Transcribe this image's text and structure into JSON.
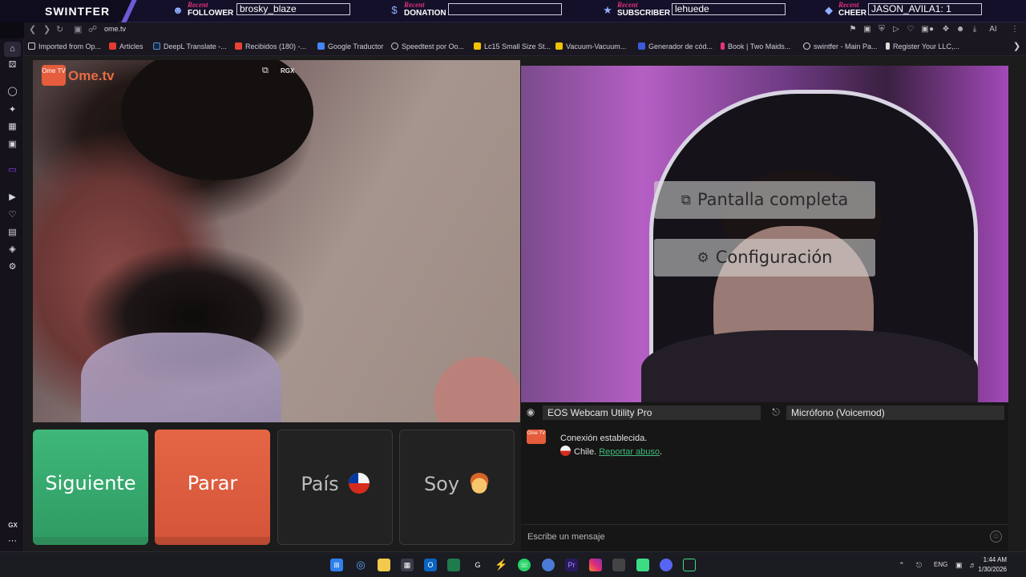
{
  "overlay": {
    "brand": "SWINTFER",
    "recent_label": "Recent",
    "follower": {
      "kind": "FOLLOWER",
      "value": "brosky_blaze"
    },
    "donation": {
      "kind": "DONATION",
      "value": ""
    },
    "subscriber": {
      "kind": "SUBSCRIBER",
      "value": "lehuede"
    },
    "cheer": {
      "kind": "CHEER",
      "value": "JASON_AVILA1: 1"
    }
  },
  "browser": {
    "url": "ome.tv",
    "bookmarks": [
      {
        "label": "Imported from Op...",
        "color": "#cfcfd8"
      },
      {
        "label": "Articles",
        "color": "#e33b2e"
      },
      {
        "label": "DeepL Translate -...",
        "color": "#0f2b46"
      },
      {
        "label": "Recibidos (180) -...",
        "color": "#ea4335"
      },
      {
        "label": "Google Traductor",
        "color": "#4285f4"
      },
      {
        "label": "Speedtest por Oo...",
        "color": "#cccccc"
      },
      {
        "label": "Lc15 Small Size St...",
        "color": "#f2c200"
      },
      {
        "label": "Vacuum-Vacuum...",
        "color": "#f2c200"
      },
      {
        "label": "Generador de cód...",
        "color": "#3b5bdb"
      },
      {
        "label": "Book | Two Maids...",
        "color": "#e6337a"
      },
      {
        "label": "swintfer - Main Pa...",
        "color": "#dddddd"
      },
      {
        "label": "Register Your LLC,...",
        "color": "#dddddd"
      }
    ],
    "sidebar_footer": "GX"
  },
  "remote_video": {
    "logo_box": "Ome TV",
    "logo_text": "Ome.tv",
    "tool_label": "RGX"
  },
  "local_video": {
    "menu_fullscreen": "Pantalla completa",
    "menu_settings": "Configuración"
  },
  "devices": {
    "camera": "EOS Webcam Utility Pro",
    "microphone": "Micrófono (Voicemod)"
  },
  "controls": {
    "next": "Siguiente",
    "stop": "Parar",
    "country": "País",
    "iam": "Soy"
  },
  "chat": {
    "status": "Conexión establecida.",
    "country": "Chile.",
    "report": "Reportar abuso",
    "report_suffix": ".",
    "placeholder": "Escribe un mensaje"
  },
  "taskbar": {
    "lang": "ENG",
    "time": "1:44 AM",
    "date": "1/30/2026"
  },
  "colors": {
    "next_green": "#3fb77a",
    "stop_orange": "#e56645",
    "overlay_bg": "#14102a",
    "recent_pink": "#e4307a"
  }
}
